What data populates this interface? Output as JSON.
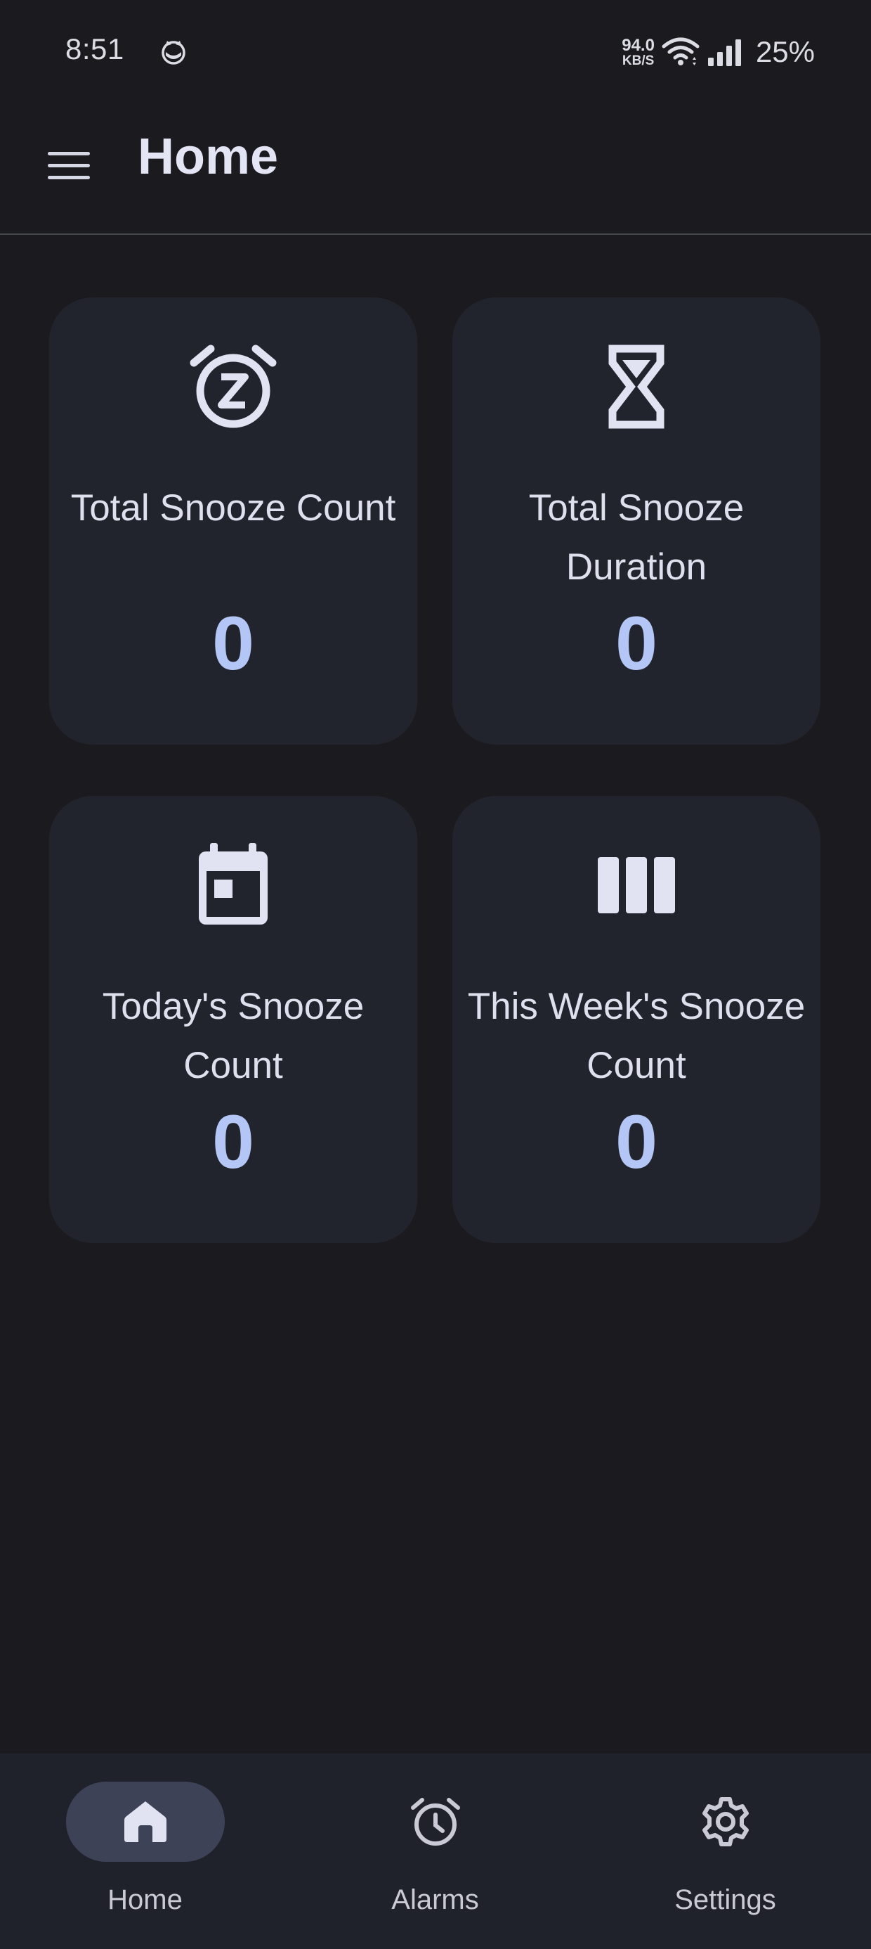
{
  "status_bar": {
    "time": "8:51",
    "app_icon": "cat-face-icon",
    "net_speed_value": "94.0",
    "net_speed_unit": "KB/S",
    "wifi_icon": "wifi-icon",
    "signal_icon": "cell-signal-icon",
    "battery": "25%"
  },
  "app_bar": {
    "menu_icon": "hamburger-menu-icon",
    "title": "Home"
  },
  "cards": [
    {
      "icon": "snooze-alarm-icon",
      "label": "Total Snooze Count",
      "value": "0"
    },
    {
      "icon": "hourglass-icon",
      "label": "Total Snooze Duration",
      "value": "0"
    },
    {
      "icon": "calendar-today-icon",
      "label": "Today's Snooze Count",
      "value": "0"
    },
    {
      "icon": "week-columns-icon",
      "label": "This Week's Snooze Count",
      "value": "0"
    }
  ],
  "bottom_nav": {
    "items": [
      {
        "icon": "home-icon",
        "label": "Home",
        "active": true
      },
      {
        "icon": "alarm-clock-icon",
        "label": "Alarms",
        "active": false
      },
      {
        "icon": "settings-gear-icon",
        "label": "Settings",
        "active": false
      }
    ]
  },
  "colors": {
    "background": "#1b1b1f",
    "card": "#22242d",
    "accent_value": "#b4c6f6",
    "nav_active_pill": "#3e4256",
    "text": "#e3e4f4"
  }
}
